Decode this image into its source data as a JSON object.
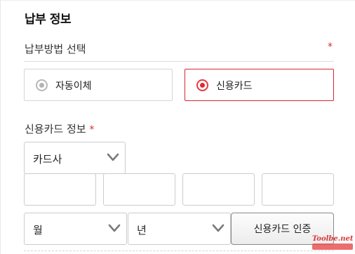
{
  "section_title": "납부 정보",
  "payment_method": {
    "label": "납부방법 선택",
    "required_mark": "*",
    "options": [
      {
        "label": "자동이체",
        "selected": false
      },
      {
        "label": "신용카드",
        "selected": true
      }
    ]
  },
  "card_info": {
    "label": "신용카드 정보",
    "required_mark": "*",
    "company_select": {
      "value": "카드사"
    },
    "number_fields": [
      "",
      "",
      "",
      ""
    ],
    "month_select": {
      "value": "월"
    },
    "year_select": {
      "value": "년"
    },
    "verify_button": "신용카드 인증"
  },
  "watermark": {
    "text": "Toolbe.net"
  },
  "colors": {
    "accent_red": "#d7262e",
    "border_gray": "#cccccc",
    "radio_unselected": "#b3b3b3"
  },
  "icons": {
    "select_arrow": "chevron-down-icon",
    "radio": "radio-icon"
  }
}
